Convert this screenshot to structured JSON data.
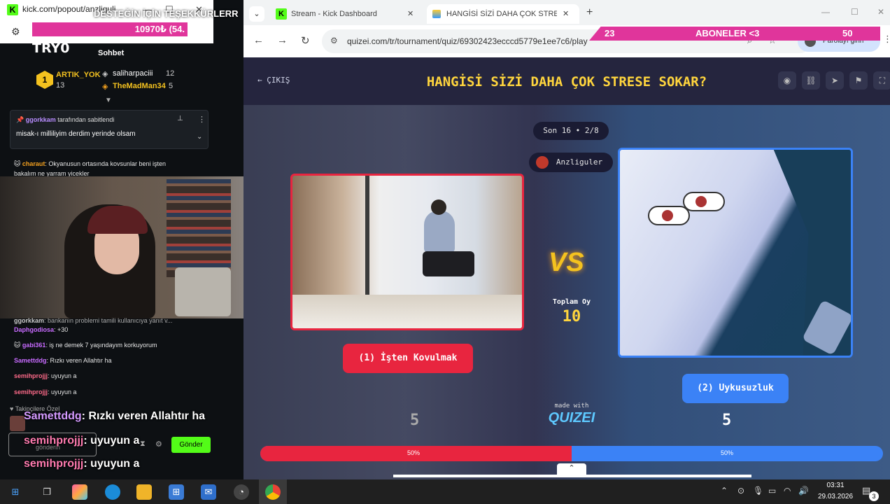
{
  "chat_window": {
    "url": "kick.com/popout/anzliguli",
    "sub_goal_overlay": "10970₺ (54.",
    "thanks_overlay": "DESTEĞİN İÇİN TEŞEKKÜRLERR",
    "channel_overlay": "TRY0",
    "tab_label": "Sohbet",
    "gifters": [
      {
        "rank": "1",
        "name": "ARTIK_YOK",
        "count": "13"
      },
      {
        "name": "saliharpaciii",
        "count": "12"
      },
      {
        "name": "TheMadMan34",
        "count": "5"
      }
    ],
    "pinned": {
      "header_user": "ggorkkam",
      "header_text": "tarafından sabitlendi",
      "message": "misak-ı milliliyim derdim yerinde olsam"
    },
    "messages_top": [
      {
        "user": "charaut",
        "text": ": Okyanusun ortasında kovsunlar beni işten"
      },
      {
        "user": "",
        "text": "bakalım ne yarram yicekler"
      }
    ],
    "messages_bottom": [
      {
        "user": "ggorkkam",
        "text": ": bankanın problemi tamili kullanıcıya yanıt v..."
      },
      {
        "user": "Daphgodiosa",
        "text": ": +30"
      },
      {
        "user": "gabi361",
        "text": ": iş ne demek 7 yaşındayım korkuyorum"
      },
      {
        "user": "Samettddg",
        "text": ": Rızkı veren Allahtır ha"
      },
      {
        "user": "semihprojjj",
        "text": ": uyuyun a"
      },
      {
        "user": "semihprojjj",
        "text": ": uyuyun a"
      }
    ],
    "followers_only": "Takipçilere Özel",
    "send_placeholder": "gönderin",
    "send_button": "Gönder",
    "big_overlay_lines": [
      {
        "user": "Samettddg",
        "text": ": Rızkı veren Allahtır ha"
      },
      {
        "user": "semihprojjj",
        "text": ": uyuyun a"
      },
      {
        "user": "semihprojjj",
        "text": ": uyuyun a"
      }
    ]
  },
  "browser": {
    "tabs": [
      {
        "label": "Stream - Kick Dashboard"
      },
      {
        "label": "HANGİSİ SİZİ DAHA ÇOK STRESE"
      }
    ],
    "url": "quizei.com/tr/tournament/quiz/69302423ecccd5779e1ee7c6/play",
    "profile_button": "Parolayı girin",
    "subs_overlay": {
      "left": "23",
      "label": "ABONELER <3",
      "right": "50"
    }
  },
  "quiz": {
    "exit_label": "ÇIKIŞ",
    "title": "HANGİSİ SİZİ DAHA ÇOK STRESE SOKAR?",
    "round": "Son 16 • 2/8",
    "creator": "Anzliguler",
    "vs": "VS",
    "total_label": "Toplam Oy",
    "total": "10",
    "option1": {
      "label": "(1) İşten Kovulmak",
      "votes": "5",
      "percent": "50%",
      "percent_value": 50
    },
    "option2": {
      "label": "(2) Uykusuzluk",
      "votes": "5",
      "percent": "50%",
      "percent_value": 50
    },
    "made_with": "made with",
    "brand": "QUIZEI"
  },
  "taskbar": {
    "time": "03:31",
    "date": "29.03.2026",
    "notif_count": "3"
  }
}
